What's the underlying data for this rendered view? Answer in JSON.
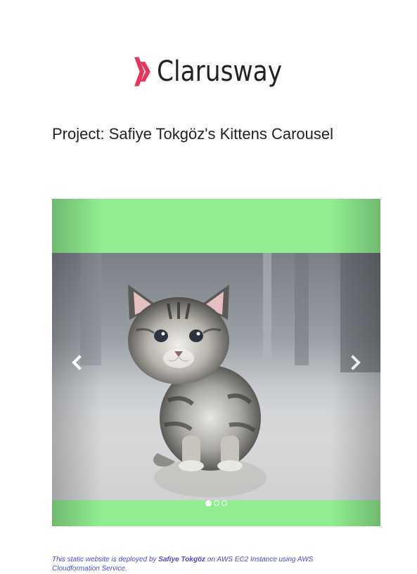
{
  "brand": {
    "name": "Clarusway",
    "accent_color": "#e8345a",
    "logo_icon": "clarusway-chevrons-icon"
  },
  "page": {
    "title": "Project: Safiye Tokgöz's Kittens Carousel"
  },
  "carousel": {
    "background_color": "#90ee90",
    "prev_icon": "chevron-left-icon",
    "next_icon": "chevron-right-icon",
    "indicator_count": 3,
    "active_index": 0,
    "current_slide": "kitten-photo"
  },
  "footer": {
    "prefix": "This static website is deployed by ",
    "author": "Safiye Tokgöz",
    "suffix": " on AWS EC2 Instance using AWS Cloudformation Service.",
    "color": "#4a4ad6"
  }
}
